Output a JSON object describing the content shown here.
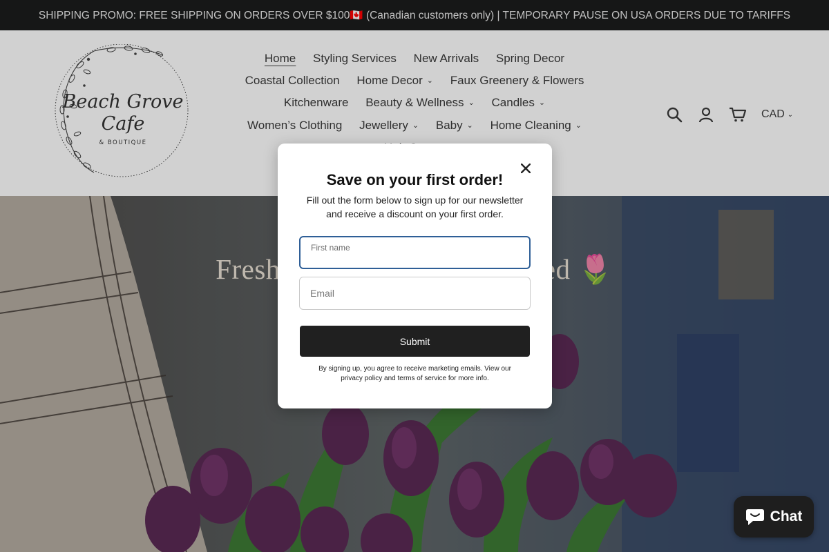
{
  "promo_bar": {
    "text": "SHIPPING PROMO: FREE SHIPPING ON ORDERS OVER $100🇨🇦 (Canadian customers only) | TEMPORARY PAUSE ON USA ORDERS DUE TO TARIFFS"
  },
  "logo": {
    "line1": "Beach Grove",
    "line2": "Cafe",
    "line3": "& BOUTIQUE"
  },
  "nav": {
    "items": [
      {
        "label": "Home",
        "active": true,
        "dropdown": false
      },
      {
        "label": "Styling Services",
        "dropdown": false
      },
      {
        "label": "New Arrivals",
        "dropdown": false
      },
      {
        "label": "Spring Decor",
        "dropdown": false
      },
      {
        "label": "Coastal Collection",
        "dropdown": false
      },
      {
        "label": "Home Decor",
        "dropdown": true
      },
      {
        "label": "Faux Greenery & Flowers",
        "dropdown": false
      },
      {
        "label": "Kitchenware",
        "dropdown": false
      },
      {
        "label": "Beauty & Wellness",
        "dropdown": true
      },
      {
        "label": "Candles",
        "dropdown": true
      },
      {
        "label": "Women’s Clothing",
        "dropdown": false
      },
      {
        "label": "Jewellery",
        "dropdown": true
      },
      {
        "label": "Baby",
        "dropdown": true
      },
      {
        "label": "Home Cleaning",
        "dropdown": true
      },
      {
        "label": "Hair Care",
        "dropdown": true
      }
    ]
  },
  "header_icons": {
    "search": "search-icon",
    "account": "account-icon",
    "cart": "cart-icon",
    "currency": "CAD"
  },
  "hero": {
    "title": "Fresh",
    "title_end": "ed",
    "emoji": "🌷"
  },
  "modal": {
    "title": "Save on your first order!",
    "subtitle": "Fill out the form below to sign up for our newsletter and receive a discount on your first order.",
    "first_name_label": "First name",
    "email_label": "Email",
    "submit_label": "Submit",
    "fineprint": "By signing up, you agree to receive marketing emails. View our privacy policy and terms of service for more info."
  },
  "chat": {
    "label": "Chat"
  }
}
